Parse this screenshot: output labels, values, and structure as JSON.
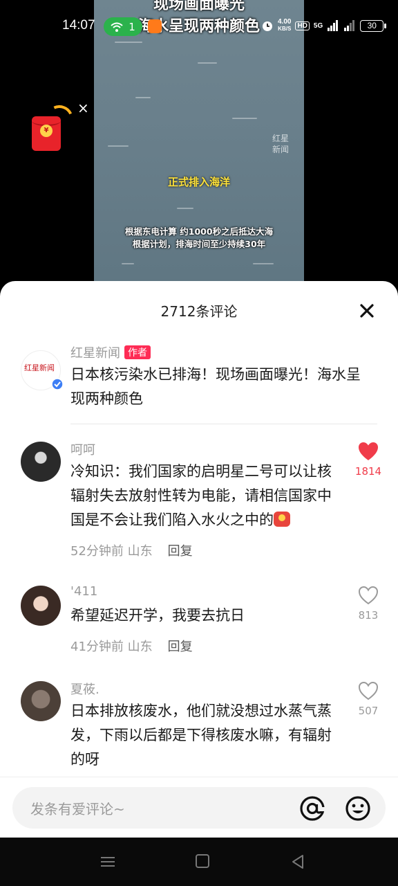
{
  "status_bar": {
    "time": "14:07",
    "wifi_count": "1",
    "net_speed_value": "4.00",
    "net_speed_unit": "KB/S",
    "hd": "HD",
    "signal": "5G",
    "battery": "30"
  },
  "video": {
    "title_line1": "现场画面曝光",
    "title_line2": "海水呈现两种颜色",
    "watermark_line1": "红星",
    "watermark_line2": "新闻",
    "caption_yellow": "正式排入海洋",
    "subtitle_line1": "根据东电计算 约1000秒之后抵达大海",
    "subtitle_line2": "根据计划，排海时间至少持续30年"
  },
  "red_packet": {
    "coin_char": "¥",
    "close": "×"
  },
  "comments_sheet": {
    "title": "2712条评论",
    "author_post": {
      "name": "红星新闻",
      "tag": "作者",
      "avatar_text": "红星新闻",
      "text": "日本核污染水已排海！现场画面曝光！海水呈现两种颜色"
    },
    "comments": [
      {
        "name": "呵呵",
        "text": "冷知识：我们国家的启明星二号可以让核辐射失去放射性转为电能，请相信国家中国是不会让我们陷入水火之中的",
        "time": "52分钟前",
        "location": "山东",
        "reply": "回复",
        "likes": "1814",
        "liked": true
      },
      {
        "name": "'411",
        "text": "希望延迟开学，我要去抗日",
        "time": "41分钟前",
        "location": "山东",
        "reply": "回复",
        "likes": "813",
        "liked": false
      },
      {
        "name": "夏莜.",
        "text": "日本排放核废水，他们就没想过水蒸气蒸发，下雨以后都是下得核废水嘛，有辐射的呀",
        "likes": "507",
        "liked": false
      }
    ]
  },
  "input_bar": {
    "placeholder": "发条有爱评论~"
  },
  "colors": {
    "like_red": "#f03c4a",
    "author_tag": "#fe2c55",
    "wifi_green": "#2bb24c"
  }
}
